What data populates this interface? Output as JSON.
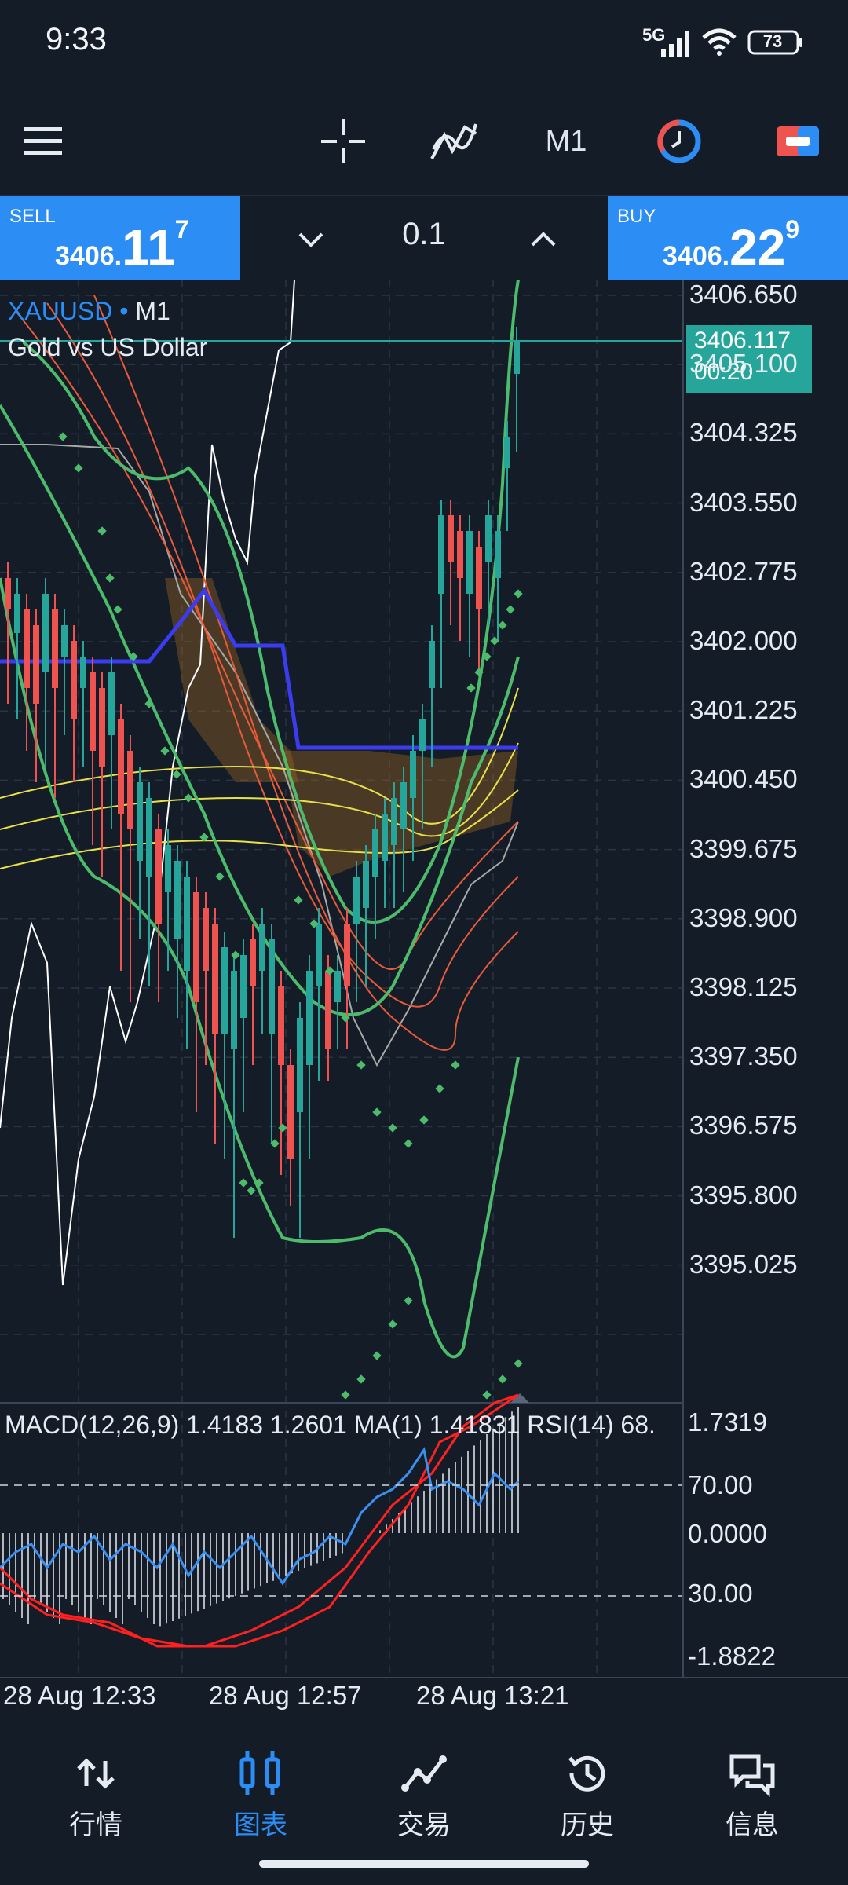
{
  "status_bar": {
    "time": "9:33",
    "network": "5G",
    "battery": "73"
  },
  "toolbar": {
    "timeframe": "M1"
  },
  "trade_bar": {
    "sell": {
      "label": "SELL",
      "price_small": "3406.",
      "price_big": "11",
      "price_sup": "7"
    },
    "buy": {
      "label": "BUY",
      "price_small": "3406.",
      "price_big": "22",
      "price_sup": "9"
    },
    "volume": "0.1"
  },
  "chart": {
    "symbol": "XAUUSD",
    "symbol_arrow": "•",
    "timeframe": "M1",
    "description": "Gold vs US Dollar",
    "current_price": "3406.117",
    "countdown": "00:20",
    "price_labels": [
      "3406.650",
      "3405.100",
      "3404.325",
      "3403.550",
      "3402.775",
      "3402.000",
      "3401.225",
      "3400.450",
      "3399.675",
      "3398.900",
      "3398.125",
      "3397.350",
      "3396.575",
      "3395.800",
      "3395.025"
    ],
    "indicator_text": "MACD(12,26,9) 1.4183 1.2601 MA(1) 1.41831 RSI(14) 68.",
    "indicator_labels": [
      "1.7319",
      "70.00",
      "0.0000",
      "30.00",
      "-1.8822"
    ],
    "time_labels": [
      "28 Aug 12:33",
      "28 Aug 12:57",
      "28 Aug 13:21"
    ],
    "colors": {
      "bull": "#26a69a",
      "bear": "#ef5350",
      "accent": "#2c8df4",
      "ma_blue": "#3b3bf0",
      "bands": "#4cbc6c",
      "yellow": "#e8e04a"
    }
  },
  "bottom_nav": [
    {
      "label": "行情",
      "icon": "quotes-icon",
      "active": false
    },
    {
      "label": "图表",
      "icon": "chart-icon",
      "active": true
    },
    {
      "label": "交易",
      "icon": "trade-icon",
      "active": false
    },
    {
      "label": "历史",
      "icon": "history-icon",
      "active": false
    },
    {
      "label": "信息",
      "icon": "messages-icon",
      "active": false
    }
  ]
}
